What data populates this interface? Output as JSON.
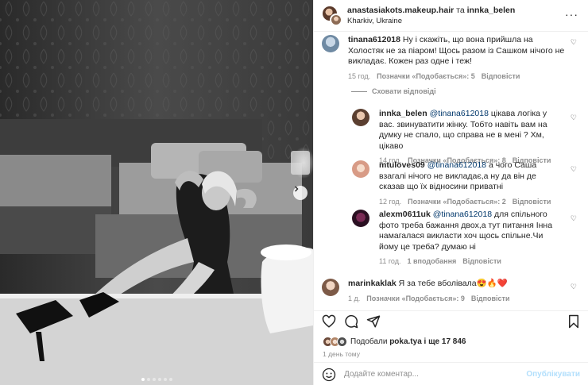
{
  "header": {
    "user1": "anastasiakots.makeup.hair",
    "joiner": "та",
    "user2": "innka_belen",
    "location": "Kharkiv, Ukraine"
  },
  "photo": {
    "slides_total": 6,
    "active_slide": 1,
    "tone": "black-and-white"
  },
  "comments": [
    {
      "user": "tinana612018",
      "text": "Ну і скажіть, що вона прийшла на Холостяк не за піаром! Щось разом із Сашком нічого не викладає. Кожен раз одне і теж!",
      "time": "15 год.",
      "likes": "Позначки «Подобається»: 5",
      "reply": "Відповісти"
    },
    {
      "user": "innka_belen",
      "mention": "@tinana612018",
      "text": "цікава логіка у вас. звинуватити жінку. Тобто навіть вам на думку не спало, що справа не в мені ? Хм, цікаво",
      "time": "14 год.",
      "likes": "Позначки «Подобається»: 8",
      "reply": "Відповісти"
    },
    {
      "user": "mtuloves09",
      "mention": "@tinana612018",
      "text": "а чого Саша взагалі нічого не викладає,а ну да він де сказав що їх відносини приватні",
      "time": "12 год.",
      "likes": "Позначки «Подобається»: 2",
      "reply": "Відповісти"
    },
    {
      "user": "alexm0611uk",
      "mention": "@tinana612018",
      "text": "для спільного фото треба бажання двох,а тут питання Інна намагалася викласти хоч щось спільне.Чи йому це треба? думаю ні",
      "time": "11 год.",
      "likes": "1 вподобання",
      "reply": "Відповісти"
    },
    {
      "user": "marinkaklak",
      "text": "Я за тебе вболівала😍🔥❤️",
      "time": "1 д.",
      "likes": "Позначки «Подобається»: 9",
      "reply": "Відповісти"
    }
  ],
  "hide_replies": "Сховати відповіді",
  "likes_line": {
    "prefix": "Подобали",
    "user": "poka.tya",
    "suffix": "і ще 17 846"
  },
  "post_date": "1 день тому",
  "add_comment": {
    "placeholder": "Додайте коментар...",
    "publish": "Опублікувати"
  },
  "colors": {
    "link": "#00376b",
    "muted": "#8e8e8e",
    "publish": "#b2dffc",
    "text": "#262626"
  }
}
